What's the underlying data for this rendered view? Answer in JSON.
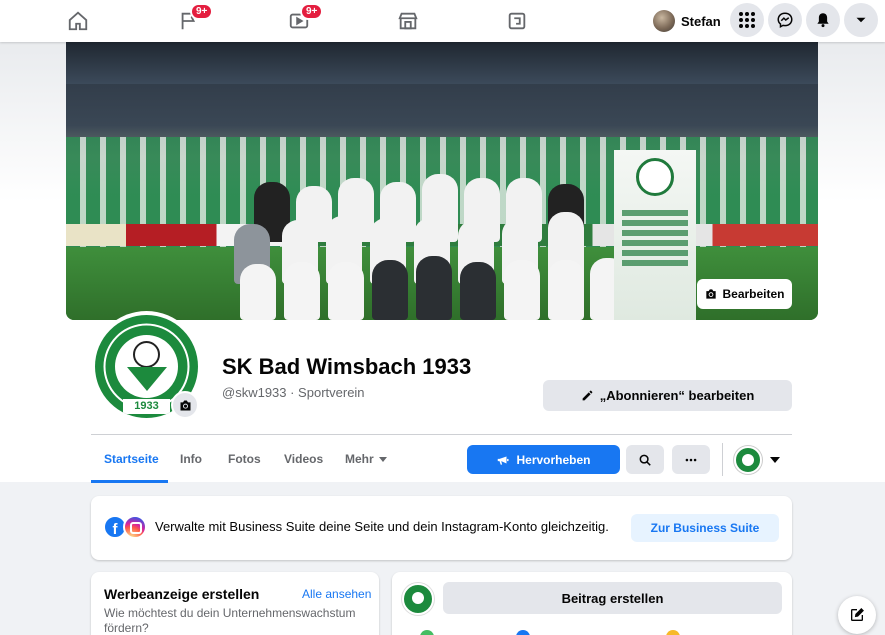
{
  "topbar": {
    "nav": [
      {
        "name": "home-icon"
      },
      {
        "name": "pages-flag-icon",
        "badge": "9+"
      },
      {
        "name": "watch-video-icon",
        "badge": "9+"
      },
      {
        "name": "marketplace-icon"
      },
      {
        "name": "gaming-icon"
      }
    ],
    "profile_name": "Stefan",
    "right_buttons": [
      "menu-grid-icon",
      "messenger-icon",
      "notifications-bell-icon",
      "account-dropdown-icon"
    ]
  },
  "cover": {
    "edit_label": "Bearbeiten"
  },
  "page": {
    "title": "SK Bad Wimsbach 1933",
    "subtitle": "@skw1933 · Sportverein",
    "follow_button": "„Abonnieren“ bearbeiten",
    "logo_year": "1933"
  },
  "tabs": [
    {
      "label": "Startseite",
      "active": true
    },
    {
      "label": "Info"
    },
    {
      "label": "Fotos"
    },
    {
      "label": "Videos"
    },
    {
      "label": "Mehr"
    }
  ],
  "actions": {
    "promote": "Hervorheben"
  },
  "business_suite": {
    "text": "Verwalte mit Business Suite deine Seite und dein Instagram-Konto gleichzeitig.",
    "button": "Zur Business Suite"
  },
  "ad_card": {
    "title": "Werbeanzeige erstellen",
    "link": "Alle ansehen",
    "description": "Wie möchtest du dein Unternehmenswachstum fördern?"
  },
  "post_card": {
    "button": "Beitrag erstellen"
  },
  "colors": {
    "accent": "#1877f2",
    "badge": "#e41e3f",
    "club_green": "#1c8a3d"
  }
}
